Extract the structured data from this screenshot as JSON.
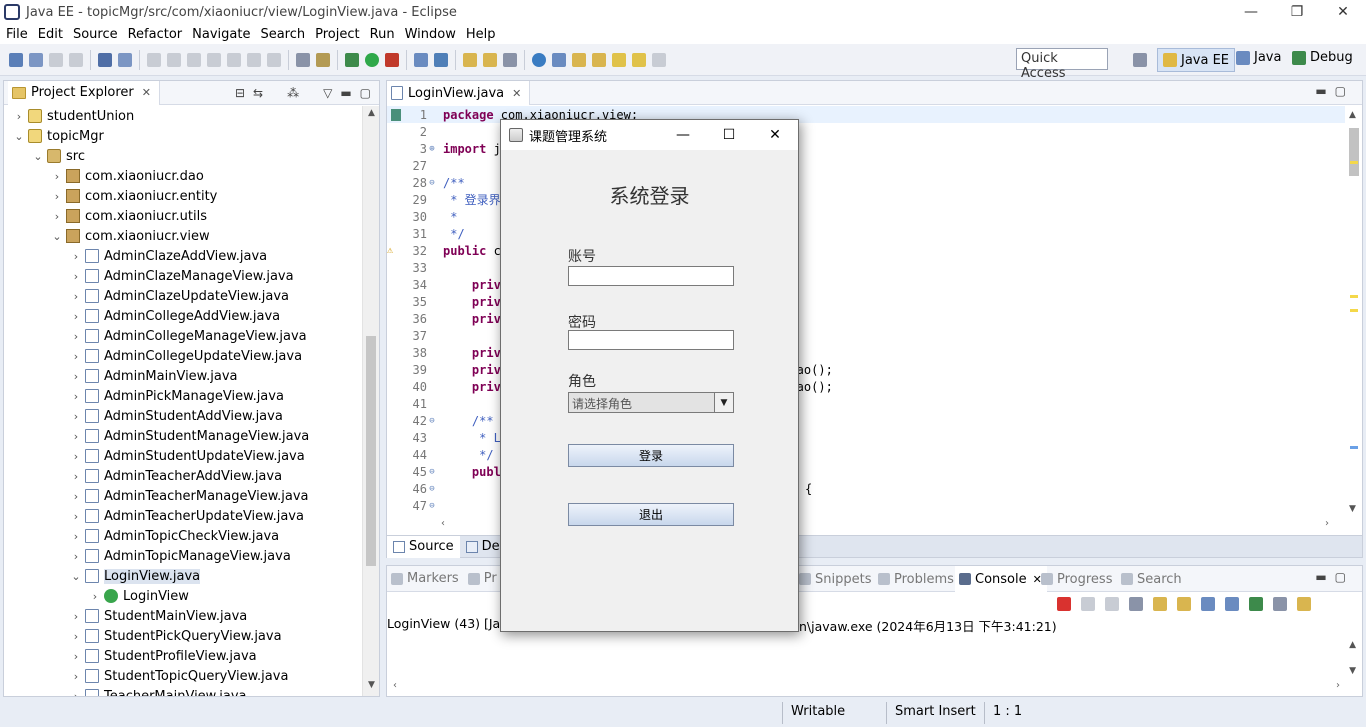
{
  "window": {
    "title": "Java EE - topicMgr/src/com/xiaoniucr/view/LoginView.java - Eclipse",
    "min": "—",
    "max": "❐",
    "close": "✕"
  },
  "menu": [
    "File",
    "Edit",
    "Source",
    "Refactor",
    "Navigate",
    "Search",
    "Project",
    "Run",
    "Window",
    "Help"
  ],
  "toolbar": {
    "quick_access": "Quick Access"
  },
  "perspectives": [
    {
      "label": "Java EE",
      "active": true
    },
    {
      "label": "Java",
      "active": false
    },
    {
      "label": "Debug",
      "active": false
    }
  ],
  "explorer": {
    "tab": "Project Explorer",
    "rows": [
      {
        "label": "studentUnion",
        "icon": "proj",
        "indent": 0,
        "arrow": "›"
      },
      {
        "label": "topicMgr",
        "icon": "proj",
        "indent": 0,
        "arrow": "⌄"
      },
      {
        "label": "src",
        "icon": "src",
        "indent": 1,
        "arrow": "⌄"
      },
      {
        "label": "com.xiaoniucr.dao",
        "icon": "pkg",
        "indent": 2,
        "arrow": "›"
      },
      {
        "label": "com.xiaoniucr.entity",
        "icon": "pkg",
        "indent": 2,
        "arrow": "›"
      },
      {
        "label": "com.xiaoniucr.utils",
        "icon": "pkg",
        "indent": 2,
        "arrow": "›"
      },
      {
        "label": "com.xiaoniucr.view",
        "icon": "pkg",
        "indent": 2,
        "arrow": "⌄"
      },
      {
        "label": "AdminClazeAddView.java",
        "icon": "java",
        "indent": 3,
        "arrow": "›"
      },
      {
        "label": "AdminClazeManageView.java",
        "icon": "java",
        "indent": 3,
        "arrow": "›"
      },
      {
        "label": "AdminClazeUpdateView.java",
        "icon": "java",
        "indent": 3,
        "arrow": "›"
      },
      {
        "label": "AdminCollegeAddView.java",
        "icon": "java",
        "indent": 3,
        "arrow": "›"
      },
      {
        "label": "AdminCollegeManageView.java",
        "icon": "java",
        "indent": 3,
        "arrow": "›"
      },
      {
        "label": "AdminCollegeUpdateView.java",
        "icon": "java",
        "indent": 3,
        "arrow": "›"
      },
      {
        "label": "AdminMainView.java",
        "icon": "java",
        "indent": 3,
        "arrow": "›"
      },
      {
        "label": "AdminPickManageView.java",
        "icon": "java",
        "indent": 3,
        "arrow": "›"
      },
      {
        "label": "AdminStudentAddView.java",
        "icon": "java",
        "indent": 3,
        "arrow": "›"
      },
      {
        "label": "AdminStudentManageView.java",
        "icon": "java",
        "indent": 3,
        "arrow": "›"
      },
      {
        "label": "AdminStudentUpdateView.java",
        "icon": "java",
        "indent": 3,
        "arrow": "›"
      },
      {
        "label": "AdminTeacherAddView.java",
        "icon": "java",
        "indent": 3,
        "arrow": "›"
      },
      {
        "label": "AdminTeacherManageView.java",
        "icon": "java",
        "indent": 3,
        "arrow": "›"
      },
      {
        "label": "AdminTeacherUpdateView.java",
        "icon": "java",
        "indent": 3,
        "arrow": "›"
      },
      {
        "label": "AdminTopicCheckView.java",
        "icon": "java",
        "indent": 3,
        "arrow": "›"
      },
      {
        "label": "AdminTopicManageView.java",
        "icon": "java",
        "indent": 3,
        "arrow": "›"
      },
      {
        "label": "LoginView.java",
        "icon": "java",
        "indent": 3,
        "arrow": "⌄",
        "selected": true
      },
      {
        "label": "LoginView",
        "icon": "class",
        "indent": 4,
        "arrow": "›"
      },
      {
        "label": "StudentMainView.java",
        "icon": "java",
        "indent": 3,
        "arrow": "›"
      },
      {
        "label": "StudentPickQueryView.java",
        "icon": "java",
        "indent": 3,
        "arrow": "›"
      },
      {
        "label": "StudentProfileView.java",
        "icon": "java",
        "indent": 3,
        "arrow": "›"
      },
      {
        "label": "StudentTopicQueryView.java",
        "icon": "java",
        "indent": 3,
        "arrow": "›"
      },
      {
        "label": "TeacherMainView.java",
        "icon": "java",
        "indent": 3,
        "arrow": "›"
      }
    ]
  },
  "editor": {
    "tab": "LoginView.java",
    "lines": [
      {
        "n": "1",
        "t": "package com.xiaoniucr.view;",
        "k": "kw1",
        "hl": true
      },
      {
        "n": "2",
        "t": ""
      },
      {
        "n": "3",
        "t": "import j",
        "k": "kw1",
        "fold": "⊕"
      },
      {
        "n": "27",
        "t": ""
      },
      {
        "n": "28",
        "t": "/**",
        "k": "cm",
        "fold": "⊖"
      },
      {
        "n": "29",
        "t": " * 登录界",
        "k": "cm"
      },
      {
        "n": "30",
        "t": " *",
        "k": "cm"
      },
      {
        "n": "31",
        "t": " */",
        "k": "cm"
      },
      {
        "n": "32",
        "t": "public c",
        "k": "kw1",
        "warn": true
      },
      {
        "n": "33",
        "t": ""
      },
      {
        "n": "34",
        "t": "    priv",
        "k": "kw1"
      },
      {
        "n": "35",
        "t": "    priv",
        "k": "kw1"
      },
      {
        "n": "36",
        "t": "    priv",
        "k": "kw1"
      },
      {
        "n": "37",
        "t": ""
      },
      {
        "n": "38",
        "t": "    priv",
        "k": "kw1",
        "tail": ");"
      },
      {
        "n": "39",
        "t": "    priv",
        "k": "kw1",
        "tail": "ntDao();"
      },
      {
        "n": "40",
        "t": "    priv",
        "k": "kw1",
        "tail": "erDao();"
      },
      {
        "n": "41",
        "t": ""
      },
      {
        "n": "42",
        "t": "    /**",
        "k": "cm",
        "fold": "⊖"
      },
      {
        "n": "43",
        "t": "     * L",
        "k": "cm"
      },
      {
        "n": "44",
        "t": "     */",
        "k": "cm"
      },
      {
        "n": "45",
        "t": "    publ",
        "k": "kw1",
        "fold": "⊖"
      },
      {
        "n": "46",
        "t": "",
        "fold": "⊖",
        "tail": "{"
      },
      {
        "n": "47",
        "t": "",
        "fold": "⊖"
      }
    ],
    "foot_tabs": [
      "Source",
      "Des"
    ]
  },
  "console": {
    "tabs": [
      {
        "label": "Markers",
        "on": false
      },
      {
        "label": "Pr",
        "on": false
      },
      {
        "label": "Snippets",
        "on": false
      },
      {
        "label": "Problems",
        "on": false
      },
      {
        "label": "Console",
        "on": true
      },
      {
        "label": "Progress",
        "on": false
      },
      {
        "label": "Search",
        "on": false
      }
    ],
    "text_left": "LoginView (43) [Java",
    "text_right": "n\\javaw.exe (2024年6月13日 下午3:41:21)"
  },
  "status": {
    "writable": "Writable",
    "insert": "Smart Insert",
    "pos": "1 : 1"
  },
  "dialog": {
    "title": "课题管理系统",
    "heading": "系统登录",
    "account_label": "账号",
    "account_value": "",
    "password_label": "密码",
    "password_value": "",
    "role_label": "角色",
    "role_placeholder": "请选择角色",
    "login_button": "登录",
    "exit_button": "退出"
  },
  "colors": {
    "accent": "#d8e4f5",
    "keyword": "#7f0055",
    "comment": "#3f5fbf"
  }
}
